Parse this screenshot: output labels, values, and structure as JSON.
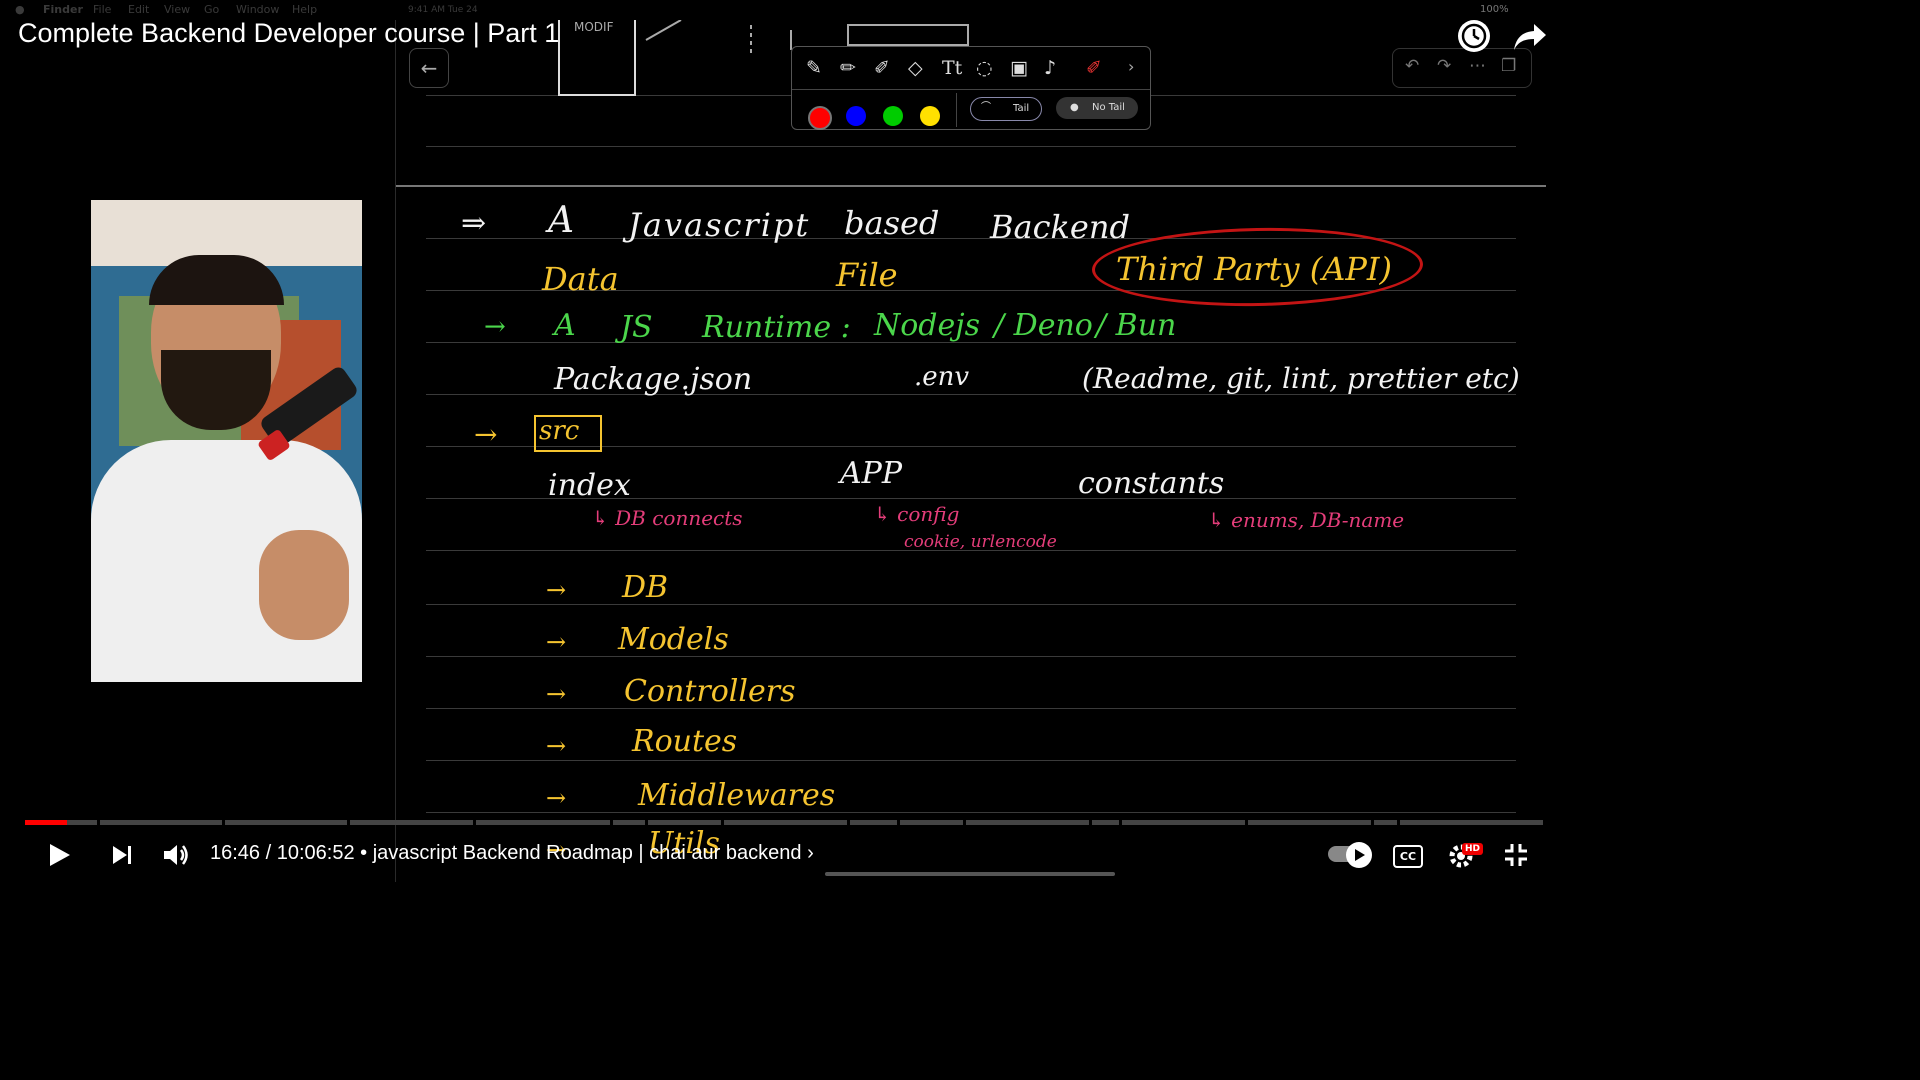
{
  "menubar": {
    "items": [
      "Finder",
      "File",
      "Edit",
      "View",
      "Go",
      "Window",
      "Help"
    ],
    "clock": "9:41 AM  Tue 24",
    "battery": "100%"
  },
  "video": {
    "title": "Complete Backend Developer course | Part 1",
    "current_time": "16:46",
    "duration": "10:06:52",
    "chapter": "javascript Backend Roadmap | chai aur backend",
    "progress_fraction": 0.0277,
    "quality_badge": "HD"
  },
  "toolbar": {
    "pen_colors": [
      "#ff0000",
      "#0000ff",
      "#00cc00",
      "#ffe000"
    ],
    "tail_label": "Tail",
    "no_tail_label": "No Tail"
  },
  "sketch": {
    "label": "MODIF"
  },
  "notes": {
    "line1": [
      "⇒",
      "A",
      "Javascript",
      "based",
      "Backend"
    ],
    "line2": [
      "Data",
      "File",
      "Third Party (API)"
    ],
    "line3": [
      "→",
      "A",
      "JS",
      "Runtime :",
      "Nodejs",
      "/ Deno",
      "/ Bun"
    ],
    "line4": [
      "Package.json",
      ".env",
      "(Readme, git, lint, prettier etc)"
    ],
    "line5": [
      "→",
      "src"
    ],
    "line6": [
      "index",
      "APP",
      "constants"
    ],
    "line7": [
      "↳ DB connects",
      "↳ config",
      "cookie, urlencode",
      "↳ enums, DB-name"
    ],
    "list": [
      {
        "arrow": "→",
        "text": "DB"
      },
      {
        "arrow": "→",
        "text": "Models"
      },
      {
        "arrow": "→",
        "text": "Controllers"
      },
      {
        "arrow": "→",
        "text": "Routes"
      },
      {
        "arrow": "→",
        "text": "Middlewares"
      },
      {
        "arrow": "→",
        "text": "Utils"
      }
    ]
  },
  "icons": {
    "play": "play-icon",
    "next": "next-icon",
    "volume": "volume-icon",
    "settings": "settings-icon",
    "exit_fullscreen": "exit-fullscreen-icon",
    "watch_later": "clock-icon",
    "share": "share-icon"
  }
}
